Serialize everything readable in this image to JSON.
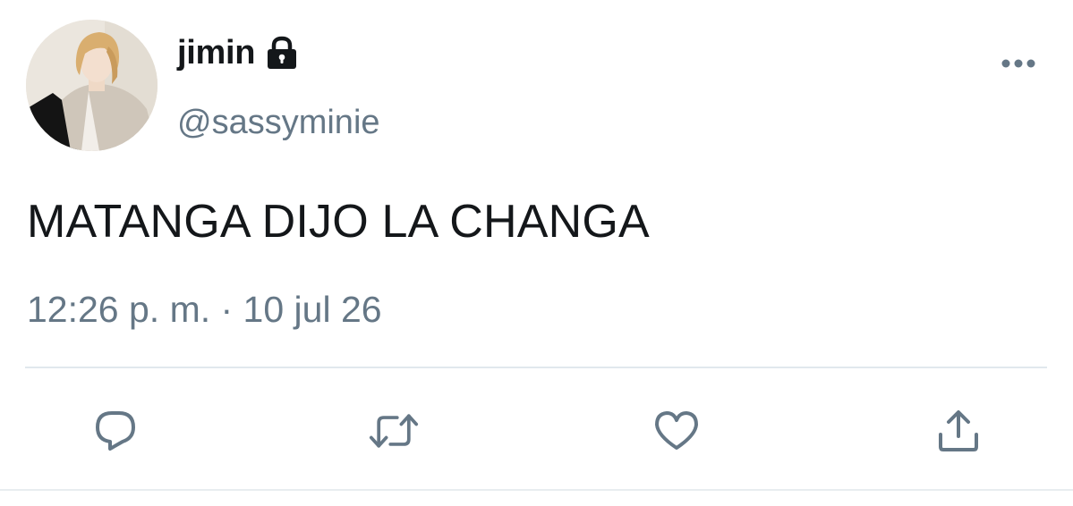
{
  "user": {
    "display_name": "jimin",
    "handle": "@sassyminie",
    "protected_icon": "lock-icon",
    "avatar_icon": "profile-photo"
  },
  "tweet": {
    "text": "MATANGA DIJO LA CHANGA",
    "timestamp": "12:26 p. m. · 10 jul 26"
  },
  "actions": {
    "more_icon": "more-options-icon",
    "reply_icon": "reply-icon",
    "retweet_icon": "retweet-icon",
    "like_icon": "heart-icon",
    "share_icon": "share-icon"
  },
  "colors": {
    "text_primary": "#14171a",
    "text_secondary": "#657786",
    "divider": "#e1e8ed"
  }
}
